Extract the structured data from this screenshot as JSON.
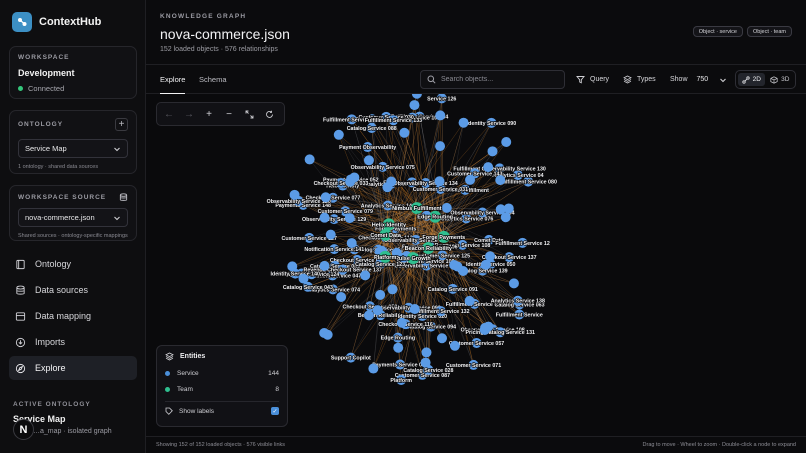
{
  "app": {
    "name": "ContextHub"
  },
  "workspace": {
    "label": "WORKSPACE",
    "name": "Development",
    "status": "Connected"
  },
  "ontology": {
    "label": "ONTOLOGY",
    "selected": "Service Map",
    "hint": "1 ontology · shared data sources"
  },
  "workspace_source": {
    "label": "WORKSPACE SOURCE",
    "selected": "nova-commerce.json",
    "hint": "Shared sources · ontology-specific mappings"
  },
  "nav": {
    "items": [
      {
        "label": "Ontology",
        "icon": "book-icon"
      },
      {
        "label": "Data sources",
        "icon": "database-icon"
      },
      {
        "label": "Data mapping",
        "icon": "map-icon"
      },
      {
        "label": "Imports",
        "icon": "import-icon"
      },
      {
        "label": "Explore",
        "icon": "explore-icon"
      }
    ]
  },
  "active_ontology": {
    "label": "ACTIVE ONTOLOGY",
    "name": "Service Map",
    "sub": "…a_map · isolated graph",
    "badge": "N"
  },
  "header": {
    "kicker": "KNOWLEDGE GRAPH",
    "title": "nova-commerce.json",
    "subtitle": "152 loaded objects · 576 relationships",
    "tags": [
      "Object · service",
      "Object · team"
    ]
  },
  "tabs": [
    "Explore",
    "Schema"
  ],
  "toolbar": {
    "search_placeholder": "Search objects...",
    "query": "Query",
    "types": "Types",
    "show_label": "Show",
    "show_value": "750",
    "dim_2d": "2D",
    "dim_3d": "3D"
  },
  "entities": {
    "title": "Entities",
    "rows": [
      {
        "label": "Service",
        "count": "144",
        "color": "#4a8fd9"
      },
      {
        "label": "Team",
        "count": "8",
        "color": "#2fbf8f"
      }
    ],
    "show_labels": "Show labels"
  },
  "footer": {
    "left": "Showing 152 of 152 loaded objects · 576 visible links",
    "right": "Drag to move · Wheel to zoom · Double-click a node to expand"
  },
  "graph": {
    "service_labels": [
      "Analytics Service 072",
      "Checkout Service 077",
      "Observability Service 065",
      "Fulfillment Service 080",
      "Fulfillment Service 087",
      "Analytics Service 076",
      "Analytics Service 074",
      "Observability Service 075",
      "Customer Service 071",
      "Checkout Service 081",
      "Customer Service 079",
      "Customer Service 057",
      "Checkout Service 058",
      "Catalog Service 063",
      "Customer Service 087",
      "Customer Service 055",
      "Payments Service 052",
      "Fulfillment Service 084",
      "Catalog Service 091",
      "Catalog Service 051",
      "Identity Service 050",
      "Catalog Service 088",
      "Observability Service 094",
      "Fulfillment Service 047",
      "Catalog Service 043",
      "Catalog Service 089",
      "Observability Service 092",
      "Fulfillment Service 045",
      "Payments Service 044",
      "Identity Service 090",
      "Analytics Service 04",
      "Payments Service 100",
      "Forge Payments",
      "Beacon Reliability",
      "Catalog Service 094",
      "Pulse Growth",
      "Platform",
      "Comet Data",
      "Helix Identity",
      "Fulfillment Service",
      "Identity Service 034",
      "Checkout Service 033",
      "Observability Service 108",
      "Nimbus Fulfillment",
      "Payments Service 108",
      "Customer Service 030",
      "Fulfillment Service 107",
      "Catalog Service 028",
      "Fulfillment Service 109",
      "Payments Service 106",
      "Payments Service 148",
      "Customer Service 031",
      "Checkout Service 113",
      "Edge Routing",
      "Catalog Service 139",
      "Identity Service 020",
      "Observability Service 134",
      "Observability Service 118",
      "Analytics Service 144",
      "Catalog Service 123",
      "Notification Service 141",
      "Fulfillment Service 12",
      "Payments Service 124",
      "Support Copilot",
      "Fulfillment Service 133",
      "Checkout Service 116",
      "Analytics Service 138",
      "Customer Service 125",
      "Fulfillment Service 132",
      "Checkout Service 137",
      "Revenue Checkout Service 137",
      "Observability Service 120",
      "Observability Service 129",
      "Pricing Catalog Service 131",
      "Payment Observability",
      "Fulfillment Observability Service 130",
      "Identity Service 140",
      "Customer Service 143",
      "Customer Service 127",
      "Service 126"
    ],
    "team_labels": [
      "Forge Payments",
      "Beacon Reliability",
      "Pulse Growth",
      "Platform",
      "Comet Data",
      "Helix Identity",
      "Nimbus Fulfillment",
      "Edge Routing"
    ]
  }
}
